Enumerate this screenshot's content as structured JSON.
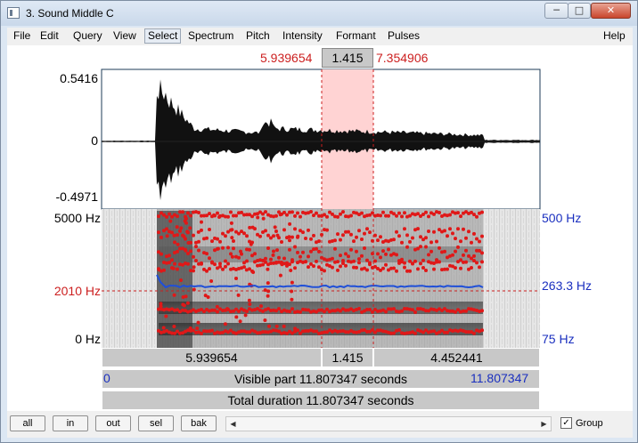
{
  "window": {
    "title": "3. Sound Middle C",
    "controls": {
      "minimize": "─",
      "maximize": "□",
      "close": "✕"
    }
  },
  "menu": [
    "File",
    "Edit",
    "Query",
    "View",
    "Select",
    "Spectrum",
    "Pitch",
    "Intensity",
    "Formant",
    "Pulses"
  ],
  "help": "Help",
  "selection": {
    "start": "5.939654",
    "duration": "1.415",
    "end": "7.354906"
  },
  "waveform": {
    "ymax": "0.5416",
    "yzero": "0",
    "ymin": "-0.4971"
  },
  "spectrogram": {
    "fmax": "5000 Hz",
    "cursor_freq": "2010 Hz",
    "fmin": "0 Hz"
  },
  "pitch_axis": {
    "max": "500 Hz",
    "cursor": "263.3 Hz",
    "min": "75 Hz"
  },
  "time_bar": {
    "left": "5.939654",
    "mid": "1.415",
    "right": "4.452441"
  },
  "visible": {
    "start": "0",
    "label": "Visible part 11.807347 seconds",
    "end": "11.807347"
  },
  "total": {
    "label": "Total duration 11.807347 seconds"
  },
  "buttons": [
    "all",
    "in",
    "out",
    "sel",
    "bak"
  ],
  "scroll": {
    "left": "◀",
    "right": "▶"
  },
  "group": {
    "label": "Group",
    "checked": "✓"
  },
  "colors": {
    "selection": "#ffd3d3",
    "formant": "#e01818",
    "pitch": "#1f4fd8",
    "red_text": "#cc1f1f",
    "blue_text": "#1a2fbf"
  }
}
